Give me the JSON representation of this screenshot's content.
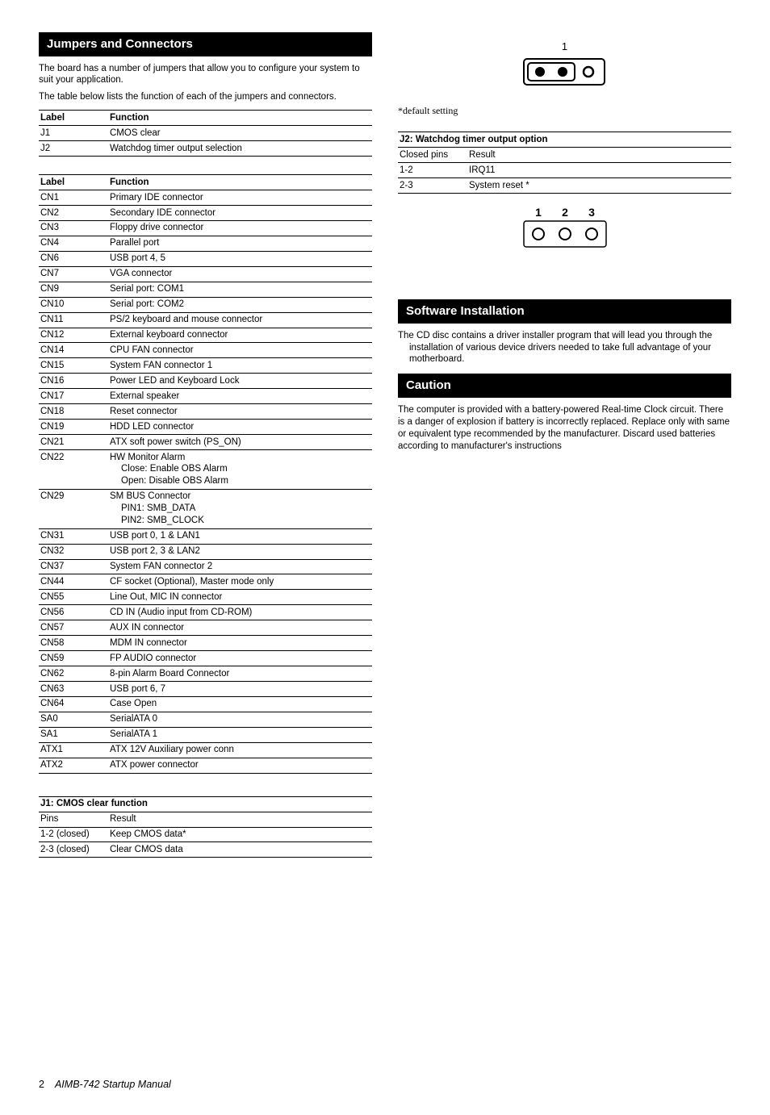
{
  "left": {
    "head": "Jumpers and Connectors",
    "intro1": "The board has a number of jumpers that allow you to configure your system to suit your application.",
    "intro2": "The table below lists the function of each of the jumpers and connectors.",
    "jumpers_header": {
      "c1": "Label",
      "c2": "Function"
    },
    "jumpers": [
      {
        "c1": "J1",
        "c2": "CMOS clear"
      },
      {
        "c1": "J2",
        "c2": "Watchdog timer output selection"
      }
    ],
    "conn_header": {
      "c1": "Label",
      "c2": "Function"
    },
    "conn": [
      {
        "c1": "CN1",
        "c2": "Primary IDE connector"
      },
      {
        "c1": "CN2",
        "c2": "Secondary IDE connector"
      },
      {
        "c1": "CN3",
        "c2": "Floppy drive connector"
      },
      {
        "c1": "CN4",
        "c2": "Parallel port"
      },
      {
        "c1": "CN6",
        "c2": "USB port 4, 5"
      },
      {
        "c1": "CN7",
        "c2": "VGA connector"
      },
      {
        "c1": "CN9",
        "c2": "Serial port: COM1"
      },
      {
        "c1": "CN10",
        "c2": "Serial port: COM2"
      },
      {
        "c1": "CN11",
        "c2": "PS/2 keyboard and mouse connector"
      },
      {
        "c1": "CN12",
        "c2": "External keyboard connector"
      },
      {
        "c1": "CN14",
        "c2": "CPU FAN connector"
      },
      {
        "c1": "CN15",
        "c2": "System FAN connector 1"
      },
      {
        "c1": "CN16",
        "c2": "Power LED and Keyboard Lock"
      },
      {
        "c1": "CN17",
        "c2": "External speaker"
      },
      {
        "c1": "CN18",
        "c2": "Reset connector"
      },
      {
        "c1": "CN19",
        "c2": "HDD LED connector"
      },
      {
        "c1": "CN21",
        "c2": "ATX soft power switch (PS_ON)"
      },
      {
        "c1": "CN22",
        "c2": "HW Monitor Alarm",
        "sub1": "Close: Enable OBS Alarm",
        "sub2": "Open: Disable OBS Alarm"
      },
      {
        "c1": "CN29",
        "c2": "SM BUS Connector",
        "sub1": "PIN1: SMB_DATA",
        "sub2": "PIN2: SMB_CLOCK"
      },
      {
        "c1": "CN31",
        "c2": "USB port 0, 1 & LAN1"
      },
      {
        "c1": "CN32",
        "c2": "USB port 2, 3 & LAN2"
      },
      {
        "c1": "CN37",
        "c2": "System FAN connector 2"
      },
      {
        "c1": "CN44",
        "c2": "CF socket (Optional), Master mode only"
      },
      {
        "c1": "CN55",
        "c2": "Line Out, MIC IN connector"
      },
      {
        "c1": "CN56",
        "c2": "CD IN (Audio input from CD-ROM)"
      },
      {
        "c1": "CN57",
        "c2": "AUX IN connector"
      },
      {
        "c1": "CN58",
        "c2": "MDM IN connector"
      },
      {
        "c1": "CN59",
        "c2": "FP AUDIO connector"
      },
      {
        "c1": "CN62",
        "c2": "8-pin Alarm Board Connector"
      },
      {
        "c1": "CN63",
        "c2": "USB port 6, 7"
      },
      {
        "c1": "CN64",
        "c2": "Case Open"
      },
      {
        "c1": "SA0",
        "c2": "SerialATA 0"
      },
      {
        "c1": "SA1",
        "c2": "SerialATA 1"
      },
      {
        "c1": "ATX1",
        "c2": "ATX 12V Auxiliary power conn"
      },
      {
        "c1": "ATX2",
        "c2": "ATX power connector"
      }
    ],
    "j1": {
      "title": "J1: CMOS clear function",
      "header": {
        "c1": "Pins",
        "c2": "Result"
      },
      "rows": [
        {
          "c1": "1-2 (closed)",
          "c2": "Keep CMOS data*"
        },
        {
          "c1": "2-3 (closed)",
          "c2": "Clear CMOS data"
        }
      ]
    }
  },
  "right": {
    "fig1_label": "1",
    "default_caption": "*default setting",
    "j2": {
      "title": "J2: Watchdog timer output option",
      "header": {
        "c1": "Closed pins",
        "c2": "Result"
      },
      "rows": [
        {
          "c1": "1-2",
          "c2": "IRQ11"
        },
        {
          "c1": "2-3",
          "c2": "System reset *"
        }
      ]
    },
    "fig2_labels": {
      "a": "1",
      "b": "2",
      "c": "3"
    },
    "software_head": "Software  Installation",
    "software_text": "The CD disc contains a driver installer program that will lead you through the installation of various device drivers needed to take full advantage of your motherboard.",
    "caution_head": "Caution",
    "caution_text": "The computer is provided with a battery-powered Real-time Clock circuit.  There is a danger of explosion if battery is incorrectly replaced.  Replace only with same or equivalent type recommended by the manufacturer.  Discard used batteries according to manufacturer's instructions"
  },
  "footer": {
    "page": "2",
    "title": "AIMB-742  Startup Manual"
  }
}
